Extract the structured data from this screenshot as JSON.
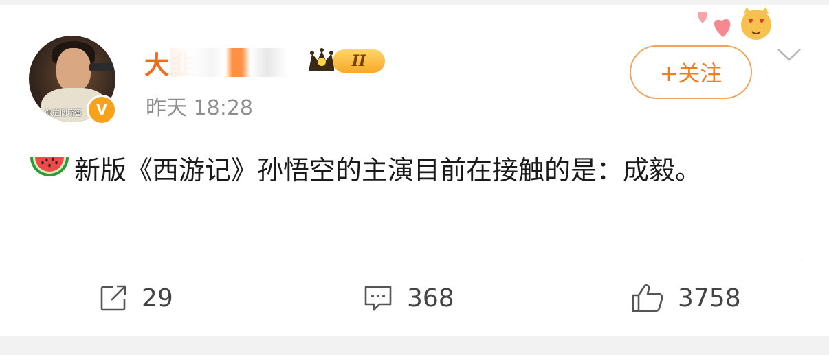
{
  "post": {
    "author": "大韭",
    "timestamp": "昨天 18:28",
    "text": "新版《西游记》孙悟空的主演目前在接触的是：成毅。",
    "avatar_caption": "你這個壞蛋",
    "verified_mark": "V",
    "vip_level": "II"
  },
  "actions": {
    "follow_label": "+关注",
    "repost_count": "29",
    "comment_count": "368",
    "like_count": "3758"
  },
  "icons": [
    "watermelon-icon",
    "repost-icon",
    "comment-icon",
    "like-icon",
    "chevron-down-icon",
    "crown-icon",
    "sticker-icon"
  ],
  "colors": {
    "accent": "#f26a1b",
    "follow_border": "#f0a35a",
    "muted": "#8e8e8e",
    "badge": "#f7a21b"
  }
}
